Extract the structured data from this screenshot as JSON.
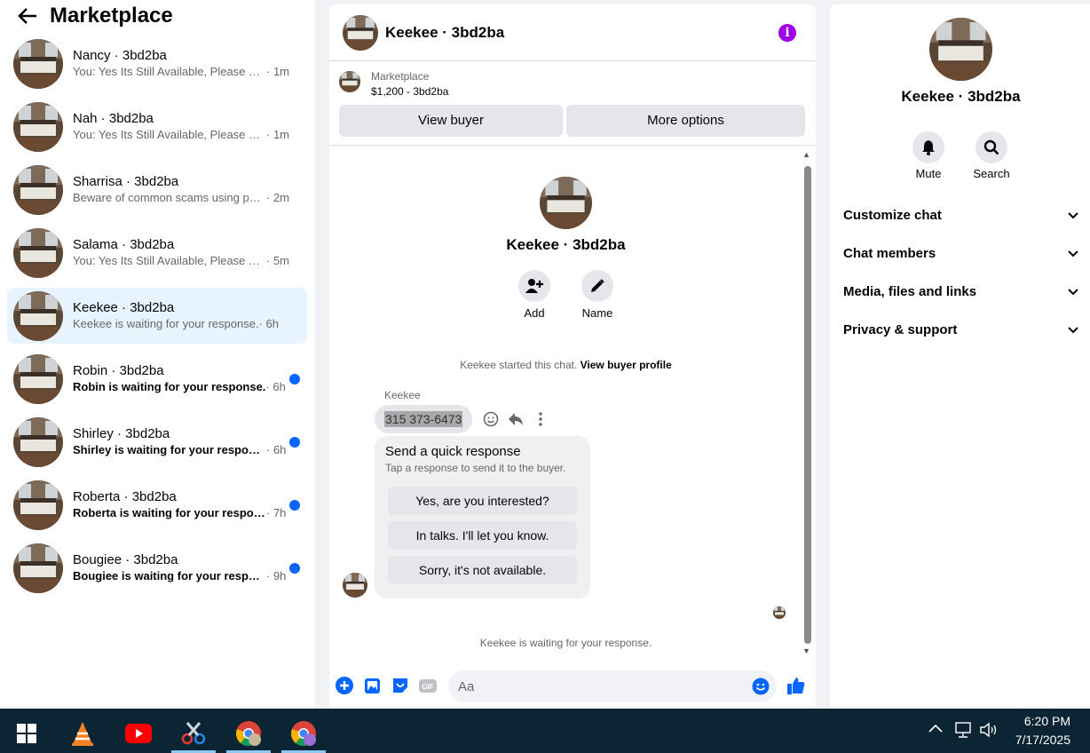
{
  "header": {
    "title": "Marketplace"
  },
  "conversations": [
    {
      "name": "Nancy · 3bd2ba",
      "message": "You: Yes Its Still Available, Please Sen...",
      "time": "· 1m",
      "unread": false,
      "active": false
    },
    {
      "name": "Nah · 3bd2ba",
      "message": "You: Yes Its Still Available, Please Sen...",
      "time": "· 1m",
      "unread": false,
      "active": false
    },
    {
      "name": "Sharrisa · 3bd2ba",
      "message": "Beware of common scams using pay...",
      "time": "· 2m",
      "unread": false,
      "active": false
    },
    {
      "name": "Salama · 3bd2ba",
      "message": "You: Yes Its Still Available, Please Sen...",
      "time": "· 5m",
      "unread": false,
      "active": false
    },
    {
      "name": "Keekee · 3bd2ba",
      "message": "Keekee is waiting for your response.",
      "time": "· 6h",
      "unread": false,
      "active": true
    },
    {
      "name": "Robin · 3bd2ba",
      "message": "Robin is waiting for your response.",
      "time": "· 6h",
      "unread": true,
      "active": false
    },
    {
      "name": "Shirley · 3bd2ba",
      "message": "Shirley is waiting for your response.",
      "time": "· 6h",
      "unread": true,
      "active": false
    },
    {
      "name": "Roberta · 3bd2ba",
      "message": "Roberta is waiting for your respon...",
      "time": "· 7h",
      "unread": true,
      "active": false
    },
    {
      "name": "Bougiee · 3bd2ba",
      "message": "Bougiee is waiting for your respon...",
      "time": "· 9h",
      "unread": true,
      "active": false
    }
  ],
  "chat": {
    "title": "Keekee · 3bd2ba",
    "marketplace_label": "Marketplace",
    "listing": "$1,200 - 3bd2ba",
    "view_buyer": "View buyer",
    "more_options": "More options",
    "profile_name": "Keekee · 3bd2ba",
    "add_label": "Add",
    "name_label": "Name",
    "started_text": "Keekee started this chat.",
    "view_profile": "View buyer profile",
    "sender": "Keekee",
    "phone": "315 373-6473",
    "quick_title": "Send a quick response",
    "quick_sub": "Tap a response to send it to the buyer.",
    "quick_responses": [
      "Yes, are you interested?",
      "In talks. I'll let you know.",
      "Sorry, it's not available."
    ],
    "waiting": "Keekee is waiting for your response.",
    "input_placeholder": "Aa"
  },
  "details": {
    "name": "Keekee · 3bd2ba",
    "mute": "Mute",
    "search": "Search",
    "sections": [
      "Customize chat",
      "Chat members",
      "Media, files and links",
      "Privacy & support"
    ]
  },
  "taskbar": {
    "time": "6:20 PM",
    "date": "7/17/2025"
  },
  "colors": {
    "accent": "#0866ff",
    "info": "#a000e6",
    "taskbar": "#0c2534",
    "active_bg": "#e7f3ff"
  }
}
